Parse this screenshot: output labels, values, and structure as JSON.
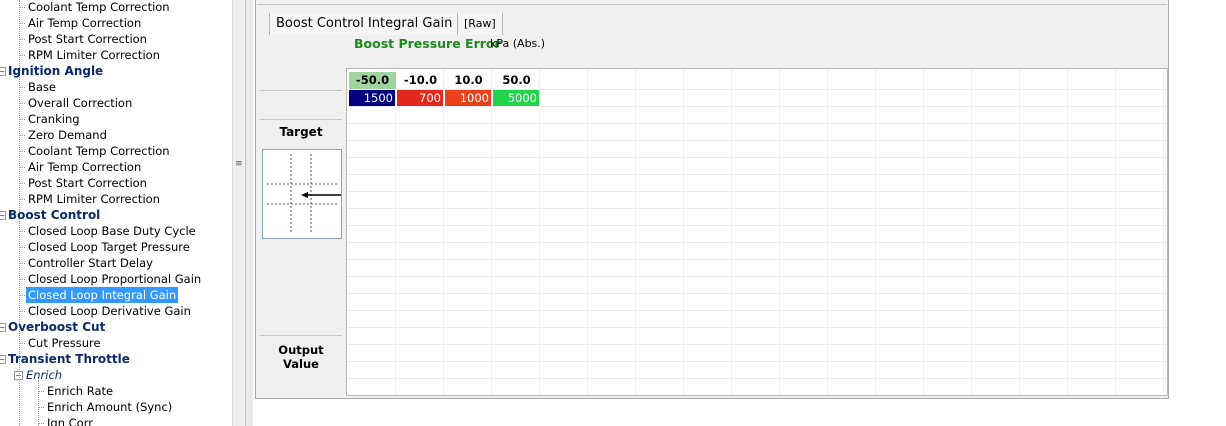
{
  "tree": {
    "items": [
      {
        "label": "Coolant Temp Correction",
        "kind": "leaf"
      },
      {
        "label": "Air Temp Correction",
        "kind": "leaf"
      },
      {
        "label": "Post Start Correction",
        "kind": "leaf"
      },
      {
        "label": "RPM Limiter Correction",
        "kind": "leaf"
      },
      {
        "label": "Ignition Angle",
        "kind": "category"
      },
      {
        "label": "Base",
        "kind": "leaf"
      },
      {
        "label": "Overall Correction",
        "kind": "leaf"
      },
      {
        "label": "Cranking",
        "kind": "leaf"
      },
      {
        "label": "Zero Demand",
        "kind": "leaf"
      },
      {
        "label": "Coolant Temp Correction",
        "kind": "leaf"
      },
      {
        "label": "Air Temp Correction",
        "kind": "leaf"
      },
      {
        "label": "Post Start Correction",
        "kind": "leaf"
      },
      {
        "label": "RPM Limiter Correction",
        "kind": "leaf"
      },
      {
        "label": "Boost Control",
        "kind": "category"
      },
      {
        "label": "Closed Loop Base Duty Cycle",
        "kind": "leaf"
      },
      {
        "label": "Closed Loop Target Pressure",
        "kind": "leaf"
      },
      {
        "label": "Controller Start Delay",
        "kind": "leaf"
      },
      {
        "label": "Closed Loop Proportional Gain",
        "kind": "leaf"
      },
      {
        "label": "Closed Loop Integral Gain",
        "kind": "leaf",
        "selected": true
      },
      {
        "label": "Closed Loop Derivative Gain",
        "kind": "leaf"
      },
      {
        "label": "Overboost Cut",
        "kind": "category"
      },
      {
        "label": "Cut Pressure",
        "kind": "leaf"
      },
      {
        "label": "Transient Throttle",
        "kind": "category"
      },
      {
        "label": "Enrich",
        "kind": "subcategory"
      },
      {
        "label": "Enrich Rate",
        "kind": "subleaf"
      },
      {
        "label": "Enrich Amount (Sync)",
        "kind": "subleaf"
      },
      {
        "label": "Ign Corr",
        "kind": "subleaf"
      }
    ]
  },
  "tabs": {
    "title": "Boost Control Integral Gain",
    "raw": "[Raw]"
  },
  "table": {
    "axis_title": "Boost Pressure Error",
    "axis_unit": "kPa (Abs.)",
    "target_label": "Target",
    "output_label": "Output Value",
    "columns": [
      "-50.0",
      "-10.0",
      "10.0",
      "50.0"
    ],
    "values": [
      "1500",
      "700",
      "1000",
      "5000"
    ],
    "cell_colors": [
      "#00007f",
      "#e5281e",
      "#e8411c",
      "#23d24d"
    ],
    "cell_text_colors": [
      "#ffffff",
      "#ffffff",
      "#ffffff",
      "#ffffff"
    ],
    "active_header_color": "#9fd49f"
  },
  "icons": {
    "splitter_grip": "grip-icon",
    "graph_arrow": "arrow-left-icon"
  }
}
